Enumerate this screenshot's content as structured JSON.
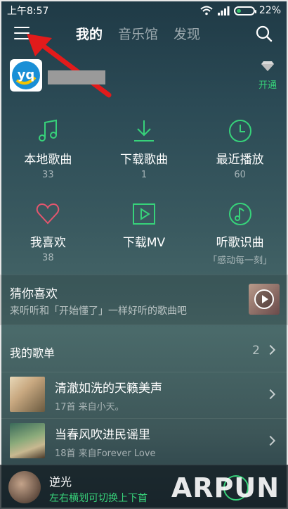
{
  "status_bar": {
    "time": "上午8:57",
    "battery": "22%"
  },
  "header": {
    "tabs": [
      "我的",
      "音乐馆",
      "发现"
    ],
    "active_tab": "我的"
  },
  "profile": {
    "vip_label": "开通",
    "avatar_text": "yq"
  },
  "grid": [
    {
      "label": "本地歌曲",
      "sub": "33",
      "icon": "music-note-icon"
    },
    {
      "label": "下载歌曲",
      "sub": "1",
      "icon": "download-icon"
    },
    {
      "label": "最近播放",
      "sub": "60",
      "icon": "clock-icon"
    },
    {
      "label": "我喜欢",
      "sub": "38",
      "icon": "heart-icon"
    },
    {
      "label": "下载MV",
      "sub": "",
      "icon": "play-box-icon"
    },
    {
      "label": "听歌识曲",
      "sub": "「感动每一刻」",
      "icon": "music-recognize-icon"
    }
  ],
  "recommend": {
    "title": "猜你喜欢",
    "desc": "来听听和「开始懂了」一样好听的歌曲吧"
  },
  "playlists": {
    "title": "我的歌单",
    "count": "2",
    "items": [
      {
        "name": "清澈如洗的天籁美声",
        "meta": "17首 来自小天。"
      },
      {
        "name": "当春风吹进民谣里",
        "meta": "18首 来自Forever Love"
      }
    ]
  },
  "player": {
    "song": "逆光",
    "hint": "左右横划可切换上下首"
  },
  "watermark": "ARPUN",
  "colors": {
    "accent": "#37d27a",
    "annotation_arrow": "#e21b1b"
  }
}
